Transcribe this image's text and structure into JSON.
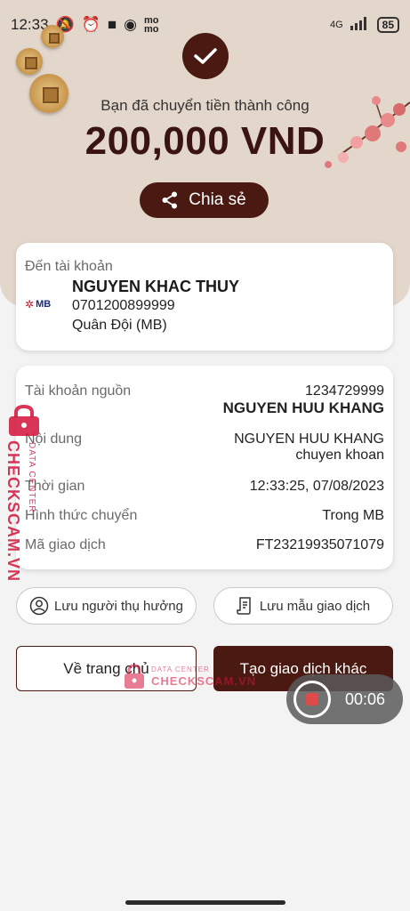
{
  "status_bar": {
    "time": "12:33",
    "network": "4G",
    "battery": "85"
  },
  "header": {
    "success_message": "Bạn đã chuyển tiền thành công",
    "amount": "200,000 VND",
    "share_label": "Chia sẻ"
  },
  "recipient": {
    "section_label": "Đến tài khoản",
    "bank_logo_text": "MB",
    "name": "NGUYEN KHAC THUY",
    "account_number": "0701200899999",
    "bank_name": "Quân Đội (MB)"
  },
  "details": {
    "source_label": "Tài khoản nguồn",
    "source_account": "1234729999",
    "source_name": "NGUYEN HUU KHANG",
    "content_label": "Nội dung",
    "content_line1": "NGUYEN HUU KHANG",
    "content_line2": "chuyen khoan",
    "time_label": "Thời gian",
    "time_value": "12:33:25, 07/08/2023",
    "method_label": "Hình thức chuyển",
    "method_value": "Trong MB",
    "txn_label": "Mã giao dịch",
    "txn_value": "FT23219935071079"
  },
  "actions": {
    "save_recipient": "Lưu người thụ hưởng",
    "save_template": "Lưu mẫu giao dịch",
    "home": "Về trang chủ",
    "new_transaction": "Tạo giao dịch khác"
  },
  "recorder": {
    "time": "00:06"
  },
  "watermark": {
    "brand": "CHECKSCAM.VN",
    "tag": "DATA CENTER"
  },
  "colors": {
    "brand_dark": "#4a1a12",
    "hero_bg": "#e3d7cc",
    "watermark": "#d4123a"
  }
}
